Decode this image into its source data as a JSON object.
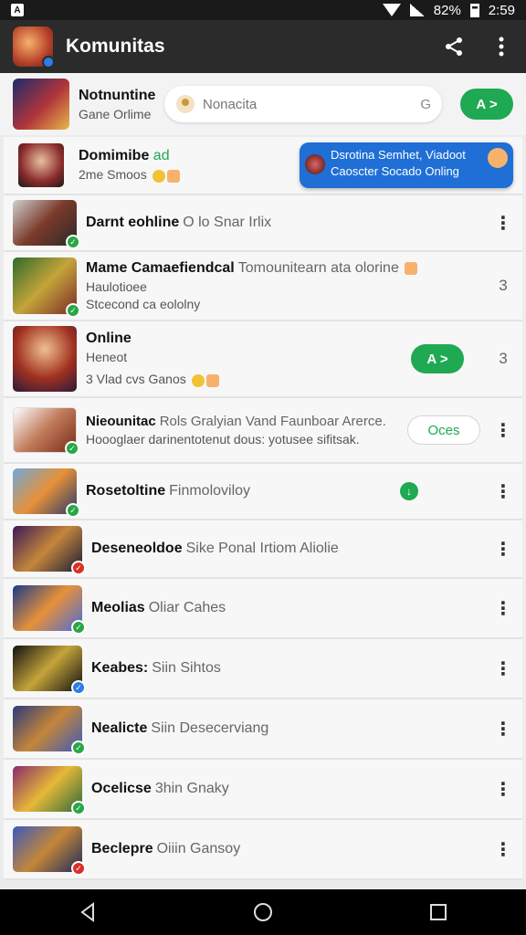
{
  "status": {
    "time": "2:59",
    "battery": "82%"
  },
  "appbar": {
    "title": "Komunitas"
  },
  "community": {
    "name": "Notnuntine",
    "subtitle": "Gane Orlime",
    "search_placeholder": "Nonacita",
    "search_end_glyph": "G",
    "join_label": "A >"
  },
  "items": [
    {
      "name": "Domimibe",
      "tag": "ad",
      "sub": "2me Smoos",
      "notif_line1": "Dsrotina Semhet, Viadoot",
      "notif_line2": "Caoscter Socado Onling"
    },
    {
      "name": "Darnt eohline",
      "desc": "O lo Snar Irlix"
    },
    {
      "name": "Mame Camaefiendcal",
      "desc": "Tomounitearn ata olorine",
      "line2": "Haulotioee",
      "line3": "Stcecond ca eololny",
      "count": "3"
    },
    {
      "name": "Online",
      "line2": "Heneot",
      "line3": "3 Vlad cvs Ganos",
      "action": "A >",
      "count": "3"
    },
    {
      "name": "Nieounitac",
      "desc": "Rols Gralyian Vand Faunboar Arerce.",
      "line2": "Hoooglaer darinentotenut dous: yotusee sifitsak.",
      "action": "Oces"
    },
    {
      "name": "Rosetoltine",
      "desc": "Finmoloviloy",
      "action": "↓"
    },
    {
      "name": "Deseneoldoe",
      "desc": "Sike Ponal Irtiom Aliolie"
    },
    {
      "name": "Meolias",
      "desc": "Oliar Cahes"
    },
    {
      "name": "Keabes:",
      "desc": "Siin Sihtos"
    },
    {
      "name": "Nealicte",
      "desc": "Siin Desecerviang"
    },
    {
      "name": "Ocelicse",
      "desc": "3hin Gnaky"
    },
    {
      "name": "Beclepre",
      "desc": "Oiiin Gansoy"
    }
  ],
  "colors": {
    "accent": "#1fa952",
    "appbar": "#2b2b2b",
    "notif": "#1f6fd6",
    "verified_green": "#28a745",
    "verified_blue": "#2b7de9",
    "verified_red": "#d93025"
  }
}
